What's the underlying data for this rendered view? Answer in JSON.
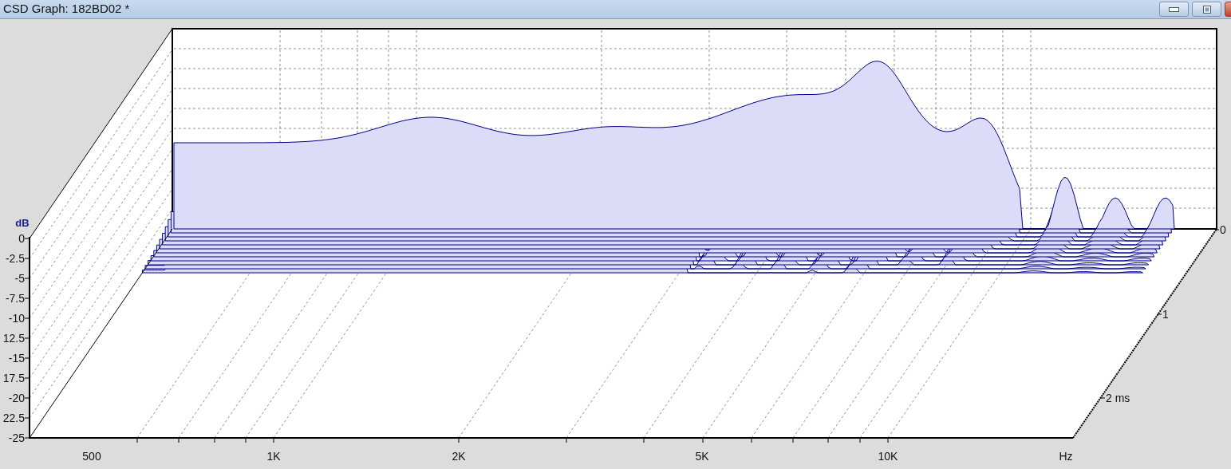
{
  "window": {
    "title": "CSD Graph: 182BD02 *"
  },
  "graph": {
    "y_axis": {
      "unit": "dB",
      "ticks": [
        "0",
        "-2.5",
        "-5",
        "-7.5",
        "-10",
        "12.5",
        "-15",
        "17.5",
        "-20",
        "22.5",
        "-25"
      ]
    },
    "x_axis": {
      "ticks": [
        "500",
        "1K",
        "2K",
        "5K",
        "10K"
      ],
      "unit": "Hz"
    },
    "time_axis": {
      "ticks": [
        "0",
        "1",
        "2 ms"
      ]
    }
  }
}
